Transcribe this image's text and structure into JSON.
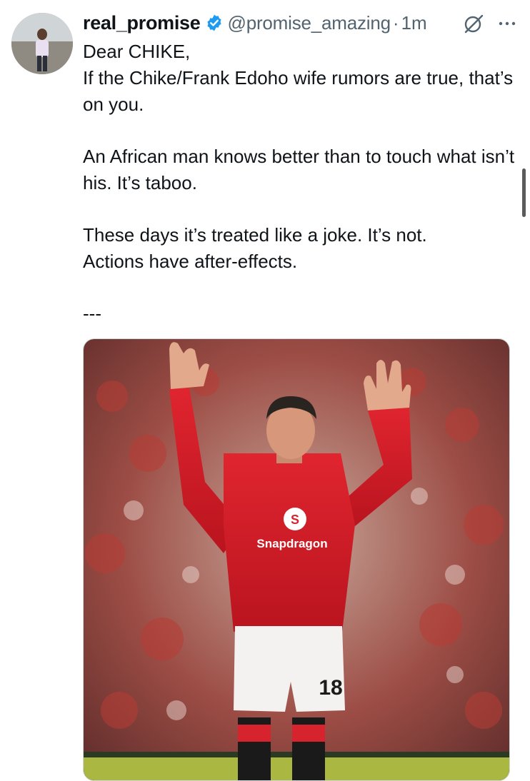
{
  "author": {
    "display_name": "real_promise",
    "handle": "@promise_amazing",
    "separator": "·",
    "time": "1m",
    "verified": true
  },
  "icons": {
    "avatar": "user-avatar",
    "verified": "verified-badge-icon",
    "grok": "grok-icon",
    "more": "more-options-icon"
  },
  "tweet": {
    "lines": [
      "Dear CHIKE,",
      "If the Chike/Frank Edoho wife rumors are true, that’s on you.",
      "",
      "An African man knows better than to touch what isn’t his. It’s taboo.",
      "",
      "These days it’s treated like a joke. It’s not.",
      "Actions have after-effects.",
      "",
      "---"
    ]
  },
  "media": {
    "sponsor_text": "Snapdragon",
    "shirt_number": "18"
  },
  "colors": {
    "verified_blue": "#1d9bf0",
    "secondary_text": "#536471",
    "jersey_red": "#d81e2a"
  }
}
